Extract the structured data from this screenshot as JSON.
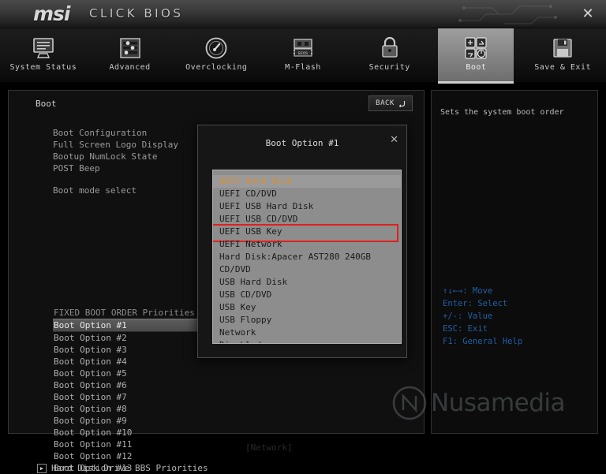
{
  "titlebar": {
    "brand": "msi",
    "product": "CLICK BIOS",
    "close_label": "✕"
  },
  "nav": {
    "items": [
      {
        "label": "System Status",
        "icon": "monitor-icon",
        "active": false
      },
      {
        "label": "Advanced",
        "icon": "sliders-icon",
        "active": false
      },
      {
        "label": "Overclocking",
        "icon": "gauge-icon",
        "active": false
      },
      {
        "label": "M-Flash",
        "icon": "bios-chip-icon",
        "active": false
      },
      {
        "label": "Security",
        "icon": "lock-icon",
        "active": false
      },
      {
        "label": "Boot",
        "icon": "boot-grid-icon",
        "active": true
      },
      {
        "label": "Save & Exit",
        "icon": "floppy-icon",
        "active": false
      }
    ]
  },
  "content": {
    "breadcrumb": "Boot",
    "back_label": "BACK",
    "back_icon": "return-arrow-icon",
    "boot_settings": [
      "Boot Configuration",
      "Full Screen Logo Display",
      "Bootup NumLock State",
      "POST Beep"
    ],
    "boot_mode_label": "Boot mode select",
    "fixed_order_header": "FIXED BOOT ORDER Priorities",
    "boot_options": [
      {
        "label": "Boot Option #1",
        "selected": true
      },
      {
        "label": "Boot Option #2",
        "selected": false
      },
      {
        "label": "Boot Option #3",
        "selected": false
      },
      {
        "label": "Boot Option #4",
        "selected": false
      },
      {
        "label": "Boot Option #5",
        "selected": false
      },
      {
        "label": "Boot Option #6",
        "selected": false
      },
      {
        "label": "Boot Option #7",
        "selected": false
      },
      {
        "label": "Boot Option #8",
        "selected": false
      },
      {
        "label": "Boot Option #9",
        "selected": false
      },
      {
        "label": "Boot Option #10",
        "selected": false
      },
      {
        "label": "Boot Option #11",
        "selected": false
      },
      {
        "label": "Boot Option #12",
        "selected": false
      },
      {
        "label": "Boot Option #13",
        "selected": false
      }
    ],
    "obscured_value": "[Network]",
    "bbs_row": {
      "label": "Hard Disk Drive BBS Priorities",
      "icon": "play-box-icon"
    }
  },
  "help": {
    "description": "Sets the system boot order",
    "keys": [
      "↑↓←→: Move",
      "Enter: Select",
      "+/-: Value",
      "ESC: Exit",
      "F1: General Help"
    ]
  },
  "modal": {
    "title": "Boot Option #1",
    "close_label": "✕",
    "items": [
      {
        "label": "UEFI Hard Disk",
        "current": true,
        "marked": false
      },
      {
        "label": "UEFI CD/DVD",
        "current": false,
        "marked": false
      },
      {
        "label": "UEFI USB Hard Disk",
        "current": false,
        "marked": false
      },
      {
        "label": "UEFI USB CD/DVD",
        "current": false,
        "marked": false
      },
      {
        "label": "UEFI USB Key",
        "current": false,
        "marked": true
      },
      {
        "label": "UEFI Network",
        "current": false,
        "marked": false
      },
      {
        "label": "Hard Disk:Apacer AST280 240GB",
        "current": false,
        "marked": false
      },
      {
        "label": "CD/DVD",
        "current": false,
        "marked": false
      },
      {
        "label": "USB Hard Disk",
        "current": false,
        "marked": false
      },
      {
        "label": "USB CD/DVD",
        "current": false,
        "marked": false
      },
      {
        "label": "USB Key",
        "current": false,
        "marked": false
      },
      {
        "label": "USB Floppy",
        "current": false,
        "marked": false
      },
      {
        "label": "Network",
        "current": false,
        "marked": false
      },
      {
        "label": "Disabled",
        "current": false,
        "marked": false
      }
    ]
  },
  "watermark": {
    "text": "Nusamedia",
    "logo": "circle-n-logo"
  },
  "colors": {
    "accent_orange": "#d5903a",
    "marker_red": "#e02020",
    "key_blue": "#1f5fa8"
  }
}
